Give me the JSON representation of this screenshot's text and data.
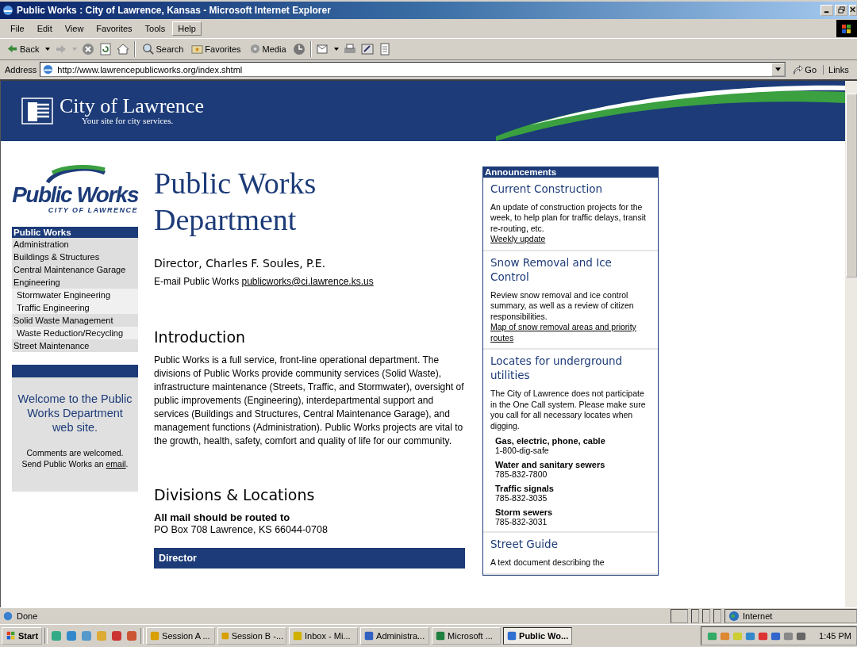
{
  "window": {
    "title": "Public Works : City of Lawrence, Kansas - Microsoft Internet Explorer"
  },
  "menu": [
    {
      "label": "File",
      "selected": false
    },
    {
      "label": "Edit",
      "selected": false
    },
    {
      "label": "View",
      "selected": false
    },
    {
      "label": "Favorites",
      "selected": false
    },
    {
      "label": "Tools",
      "selected": false
    },
    {
      "label": "Help",
      "selected": true
    }
  ],
  "toolbar": {
    "back": "Back",
    "search": "Search",
    "favorites": "Favorites",
    "media": "Media"
  },
  "address": {
    "label": "Address",
    "url": "http://www.lawrencepublicworks.org/index.shtml",
    "go": "Go",
    "links": "Links"
  },
  "banner": {
    "title": "City of Lawrence",
    "tagline": "Your site for city services."
  },
  "sidebar": {
    "logo_title": "Public Works",
    "logo_subtitle": "CITY OF LAWRENCE",
    "nav_title": "Public Works",
    "items": [
      {
        "label": "Administration"
      },
      {
        "label": "Buildings & Structures"
      },
      {
        "label": "Central Maintenance Garage"
      },
      {
        "label": "Engineering",
        "children": [
          {
            "label": "Stormwater Engineering"
          },
          {
            "label": "Traffic Engineering"
          }
        ]
      },
      {
        "label": "Solid Waste Management",
        "children": [
          {
            "label": "Waste Reduction/Recycling"
          }
        ]
      },
      {
        "label": "Street Maintenance"
      }
    ],
    "welcome": {
      "heading": "Welcome to the Public Works Department web site.",
      "text": "Comments are welcomed. Send Public Works an",
      "link": "email",
      "tail": "."
    }
  },
  "main": {
    "title": "Public Works Department",
    "director": "Director, Charles F. Soules, P.E.",
    "email_label": "E-mail Public Works",
    "email": "publicworks@ci.lawrence.ks.us",
    "intro_heading": "Introduction",
    "intro": "Public Works is a full service, front-line operational department. The divisions of Public Works provide community services (Solid Waste), infrastructure maintenance (Streets, Traffic, and Stormwater), oversight of public improvements (Engineering), interdepartmental support and services (Buildings and Structures, Central Maintenance Garage), and management functions (Administration). Public Works projects are vital to the growth, health, safety, comfort and quality of life for our community.",
    "divisions_heading": "Divisions & Locations",
    "mail_heading": "All mail should be routed to",
    "mail_address": "PO Box 708 Lawrence, KS 66044-0708",
    "table_header": "Director"
  },
  "announcements": {
    "header": "Announcements",
    "items": [
      {
        "title": "Current Construction",
        "text": "An update of construction projects for the week, to help plan for traffic delays, transit re-routing, etc.",
        "link": "Weekly update"
      },
      {
        "title": "Snow Removal and Ice Control",
        "text": "Review snow removal and ice control summary, as well as a review of citizen responsibilities.",
        "link": "Map of snow removal areas and priority routes"
      },
      {
        "title": "Locates for underground utilities",
        "text": "The City of Lawrence does not participate in the One Call system. Please make sure you call for all necessary locates when digging.",
        "contacts": [
          {
            "name": "Gas, electric, phone, cable",
            "phone": "1-800-dig-safe"
          },
          {
            "name": "Water and sanitary sewers",
            "phone": "785-832-7800"
          },
          {
            "name": "Traffic signals",
            "phone": "785-832-3035"
          },
          {
            "name": "Storm sewers",
            "phone": "785-832-3031"
          }
        ]
      },
      {
        "title": "Street Guide",
        "text": "A text document describing the"
      }
    ]
  },
  "status_bar": {
    "text": "Done",
    "zone": "Internet"
  },
  "taskbar": {
    "start": "Start",
    "tasks": [
      {
        "label": "Session A ...",
        "selected": false
      },
      {
        "label": "Session B -...",
        "selected": false
      },
      {
        "label": "Inbox - Mi...",
        "selected": false
      },
      {
        "label": "Administra...",
        "selected": false
      },
      {
        "label": "Microsoft ...",
        "selected": false
      },
      {
        "label": "Public Wo...",
        "selected": true
      }
    ],
    "clock": "1:45 PM"
  }
}
